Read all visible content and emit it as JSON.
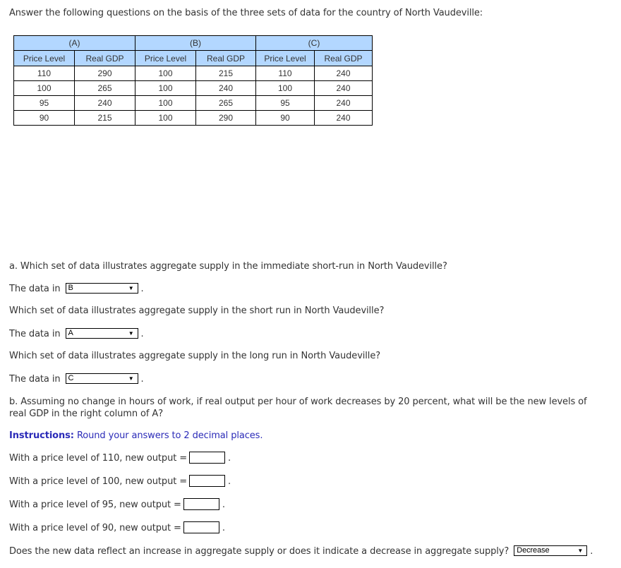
{
  "intro": "Answer the following questions on the basis of the three sets of data for the country of North Vaudeville:",
  "table": {
    "groups": [
      "(A)",
      "(B)",
      "(C)"
    ],
    "columns": [
      "Price Level",
      "Real GDP",
      "Price Level",
      "Real GDP",
      "Price Level",
      "Real GDP"
    ],
    "rows": [
      [
        "110",
        "290",
        "100",
        "215",
        "110",
        "240"
      ],
      [
        "100",
        "265",
        "100",
        "240",
        "100",
        "240"
      ],
      [
        "95",
        "240",
        "100",
        "265",
        "95",
        "240"
      ],
      [
        "90",
        "215",
        "100",
        "290",
        "90",
        "240"
      ]
    ]
  },
  "part_a": {
    "q1": "a. Which set of data illustrates aggregate supply in the immediate short-run in North Vaudeville?",
    "a1_prefix": "The data in",
    "a1_value": "B",
    "q2": "Which set of data illustrates aggregate supply in the short run in North Vaudeville?",
    "a2_prefix": "The data in",
    "a2_value": "A",
    "q3": "Which set of data illustrates aggregate supply in the long run in North Vaudeville?",
    "a3_prefix": "The data in",
    "a3_value": "C",
    "dropdown_arrow": "▼",
    "end_punct": "."
  },
  "part_b": {
    "question": "b. Assuming no change in hours of work, if real output per hour of work decreases by 20 percent, what will be the new levels of real GDP in the right column of A?",
    "instructions_label": "Instructions:",
    "instructions_text": " Round your answers to 2 decimal places.",
    "inputs": [
      {
        "label": "With a price level of 110, new output =",
        "value": ""
      },
      {
        "label": "With a price level of 100, new output =",
        "value": ""
      },
      {
        "label": "With a price level of 95, new output =",
        "value": ""
      },
      {
        "label": "With a price level of 90, new output =",
        "value": ""
      }
    ],
    "final_question": "Does the new data reflect an increase in aggregate supply or does it indicate a decrease in aggregate supply?",
    "final_value": "Decrease"
  },
  "colors": {
    "header_fill": "#b3d7ff",
    "instructions": "#2b2bb8",
    "text": "#333333"
  }
}
